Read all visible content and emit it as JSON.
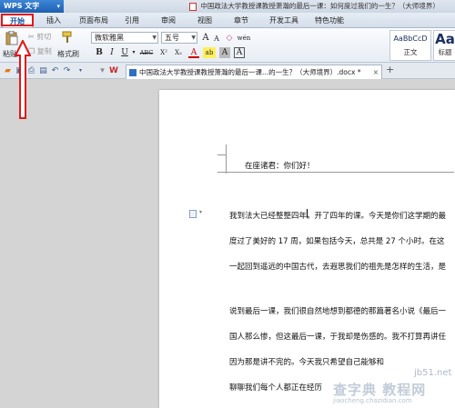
{
  "app": {
    "name": "WPS 文字",
    "menu_arrow": "▾"
  },
  "title_bar": {
    "text": "中国政法大学教授课教授萧瀚的最后一课：如何度过我们的一生？（大师境界）"
  },
  "menu_tabs": [
    "开始",
    "插入",
    "页面布局",
    "引用",
    "审阅",
    "视图",
    "章节",
    "开发工具",
    "特色功能"
  ],
  "ribbon": {
    "paste_label": "粘贴",
    "paste_arrow": "▾",
    "cut_label": "剪切",
    "copy_label": "复制",
    "format_painter_label": "格式刷",
    "font_family": "微软雅黑",
    "font_size": "五号",
    "grow_font": "A",
    "shrink_font": "A",
    "clear_format": "◇",
    "pinyin": "wén",
    "bold": "B",
    "italic": "I",
    "underline": "U",
    "underline_arrow": "▾",
    "strikethrough": "ABC",
    "superscript": "X²",
    "subscript": "X₂",
    "font_color": "A",
    "highlight": "ab",
    "char_shade": "A",
    "char_border": "A",
    "style_normal_preview": "AaBbCcD",
    "style_normal_label": "正文",
    "style_heading_preview": "Aa",
    "style_heading_label": "标题"
  },
  "document_tab": {
    "name": "中国政法大学教授课教授萧瀚的最后一课...的一生？（大师境界）.docx *",
    "close": "×"
  },
  "new_tab": "+",
  "document": {
    "greeting": "在座诸君：你们好！",
    "paragraphs": [
      "我到法大已经整整四年，开了四年的课。今天是你们这学期的最",
      "度过了美好的 17 周，如果包括今天，总共是 27 个小时。在这",
      "一起回到遥远的中国古代，去遐思我们的祖先是怎样的生活，是",
      "说到最后一课，我们很自然地想到都德的那篇著名小说《最后一",
      "国人那么惨，但这最后一课，于我却是伤感的。我不打算再讲任",
      "因为那是讲不完的。今天我只希望自己能够和",
      "聊聊我们每个人都正在经历"
    ]
  },
  "watermark": {
    "line1": "jb51.net",
    "line2": "查字典 教程网",
    "line3": "jiaocheng.chazidian.com"
  },
  "colors": {
    "accent_blue": "#1f5fb0",
    "annotation_red": "#e01818"
  }
}
